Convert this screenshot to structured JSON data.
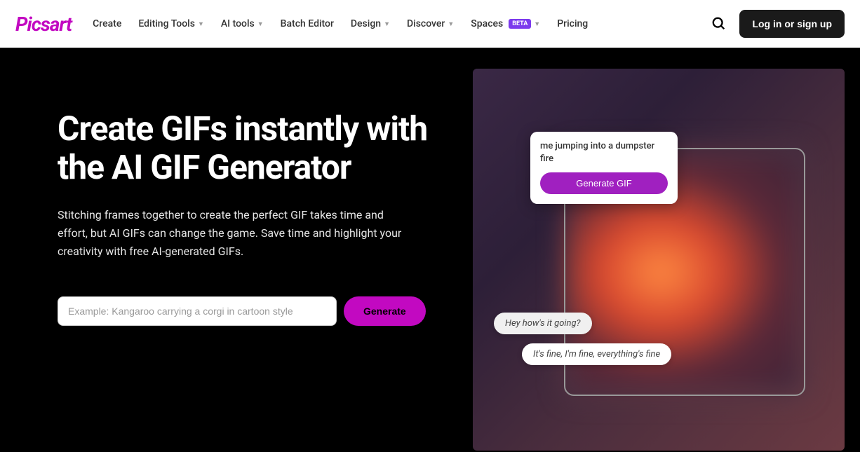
{
  "brand": "Picsart",
  "nav": {
    "create": "Create",
    "editing": "Editing Tools",
    "ai": "AI tools",
    "batch": "Batch Editor",
    "design": "Design",
    "discover": "Discover",
    "spaces": "Spaces",
    "beta": "BETA",
    "pricing": "Pricing"
  },
  "login": "Log in or sign up",
  "hero": {
    "title": "Create GIFs instantly with the AI GIF Generator",
    "desc": "Stitching frames together to create the perfect GIF takes time and effort, but AI GIFs can change the game. Save time and highlight your creativity with free AI-generated GIFs.",
    "placeholder": "Example: Kangaroo carrying a corgi in cartoon style",
    "generate": "Generate"
  },
  "demo": {
    "prompt": "me jumping into a dumpster fire",
    "generateGif": "Generate GIF",
    "chat1": "Hey how's it going?",
    "chat2": "It's fine, I'm fine, everything's fine"
  }
}
